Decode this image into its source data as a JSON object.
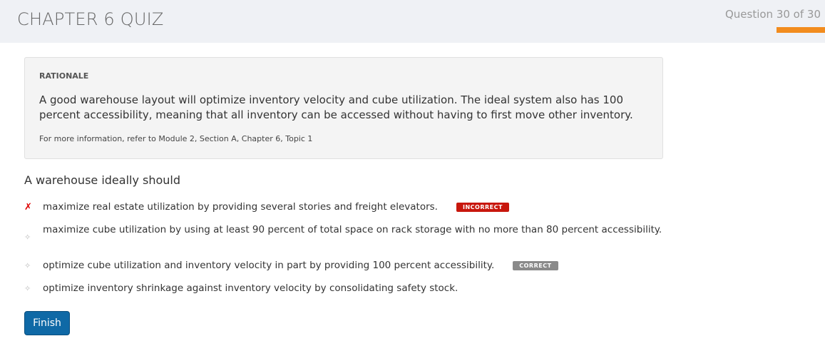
{
  "header": {
    "title": "CHAPTER 6 QUIZ",
    "question_counter": "Question 30 of 30",
    "progress_percent": 100,
    "accent": "#f28c1e"
  },
  "rationale": {
    "heading": "RATIONALE",
    "text": "A good warehouse layout will optimize inventory velocity and cube utilization. The ideal system also has 100 percent accessibility, meaning that all inventory can be accessed without having to first move other inventory.",
    "reference": "For more information, refer to Module 2, Section A, Chapter 6, Topic 1"
  },
  "question": "A warehouse ideally should",
  "options": [
    {
      "text": "maximize real estate utilization by providing several stories and freight elevators.",
      "status": "selected-incorrect",
      "badge": "INCORRECT",
      "badge_color": "#c8170d",
      "icon": "x-mark-icon"
    },
    {
      "text": "maximize cube utilization by using at least 90 percent of total space on rack storage with no more than 80 percent accessibility.",
      "icon": "diamond-icon"
    },
    {
      "text": "optimize cube utilization and inventory velocity in part by providing 100 percent accessibility.",
      "status": "correct",
      "badge": "CORRECT",
      "badge_color": "#8a8a8a",
      "icon": "diamond-icon"
    },
    {
      "text": "optimize inventory shrinkage against inventory velocity by consolidating safety stock.",
      "icon": "diamond-icon"
    }
  ],
  "finish_label": "Finish"
}
